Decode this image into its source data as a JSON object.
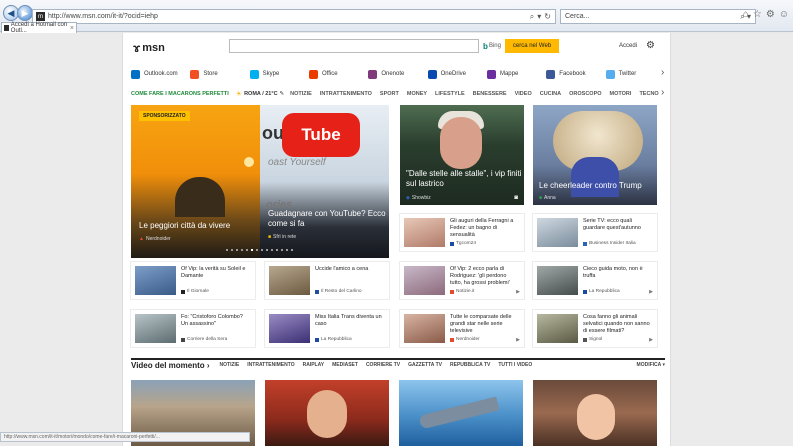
{
  "browser": {
    "url": "http://www.msn.com/it-it/?ocid=iehp",
    "search_placeholder": "Cerca...",
    "tab_title": "Accedi a Hotmail con Outl...",
    "status_url": "http://www.msn.com/it-it/motori/mondo/come-fare/i-macaroni-perfetti/..."
  },
  "header": {
    "logo_text": "msn",
    "bing_label": "Bing",
    "search_web_label": "cerca nel Web",
    "signin_label": "Accedi"
  },
  "apps": [
    {
      "label": "Outlook.com",
      "color": "#0072c6"
    },
    {
      "label": "Store",
      "color": "#f25022"
    },
    {
      "label": "Skype",
      "color": "#00aff0"
    },
    {
      "label": "Office",
      "color": "#eb3c00"
    },
    {
      "label": "Onenote",
      "color": "#80397b"
    },
    {
      "label": "OneDrive",
      "color": "#094ab2"
    },
    {
      "label": "Mappe",
      "color": "#6b2e9e"
    },
    {
      "label": "Facebook",
      "color": "#3b5998"
    },
    {
      "label": "Twitter",
      "color": "#55acee"
    }
  ],
  "catbar": {
    "promo": "COME FARE I MACARONS PERFETTI",
    "weather": "ROMA / 21°C",
    "categories": [
      "NOTIZIE",
      "INTRATTENIMENTO",
      "SPORT",
      "MONEY",
      "LIFESTYLE",
      "BENESSERE",
      "VIDEO",
      "CUCINA",
      "OROSCOPO",
      "MOTORI",
      "TECNO"
    ]
  },
  "hero": {
    "sponsor_label": "SPONSORIZZATO",
    "left_caption": "Le peggiori città da vivere",
    "left_source": "Nerdnoider",
    "right_caption": "Guadagnare con YouTube? Ecco come si fa",
    "right_source": "Sfrì in rete",
    "yt_text": "Tube",
    "yt_prefix": "ou",
    "broadcast_text": "oast Yourself",
    "stories_text": "ories",
    "dots_total": 14,
    "dots_active": 5
  },
  "big_tiles": [
    {
      "caption": "\"Dalle stelle alle stalle\", i vip finiti sul lastrico",
      "source": "Showbiz"
    },
    {
      "caption": "Le cheerleader contro Trump",
      "source": "Anna"
    }
  ],
  "small_tiles": [
    {
      "title": "Gli auguri della Ferragni a Fedez: un bagno di sensualità",
      "source": "Tgcom24",
      "src_color": "#1a4ba0"
    },
    {
      "title": "Serie TV: ecco quali guardare quest'autunno",
      "source": "Business Insider Italia",
      "src_color": "#2b63b8"
    },
    {
      "title": "Of Vip: la verità su Soleil e Damante",
      "source": "Il Giornale",
      "src_color": "#222222"
    },
    {
      "title": "Uccide l'amico a cena",
      "source": "Il Resto del Carlino",
      "src_color": "#1f4f9e"
    },
    {
      "title": "Of Vip: 2 ecco parla di Rodriguez: 'gli perdono tutto, ha grossi problemi'",
      "source": "Notizie.it",
      "src_color": "#e24a2a"
    },
    {
      "title": "Cieco guida moto, non è truffa",
      "source": "La Repubblica",
      "src_color": "#1a4ba0"
    },
    {
      "title": "Fo: \"Cristoforo Colombo? Un assassino\"",
      "source": "Corriere della Sera",
      "src_color": "#444444"
    },
    {
      "title": "Miss Italia Trans diventa un caso",
      "source": "La Repubblica",
      "src_color": "#1a4ba0"
    },
    {
      "title": "Tutte le comparsate delle grandi star nelle serie televisive",
      "source": "Nerdnoider",
      "src_color": "#e24a2a"
    },
    {
      "title": "Cosa fanno gli animali selvatici quando non sanno di essere filmati?",
      "source": "Signol",
      "src_color": "#555555"
    }
  ],
  "video": {
    "title": "Video del momento",
    "tabs": [
      "NOTIZIE",
      "INTRATTENIMENTO",
      "RAIPLAY",
      "MEDIASET",
      "CORRIERE TV",
      "GAZZETTA TV",
      "REPUBBLICA TV",
      "TUTTI I VIDEO"
    ],
    "modifica": "MODIFICA"
  }
}
